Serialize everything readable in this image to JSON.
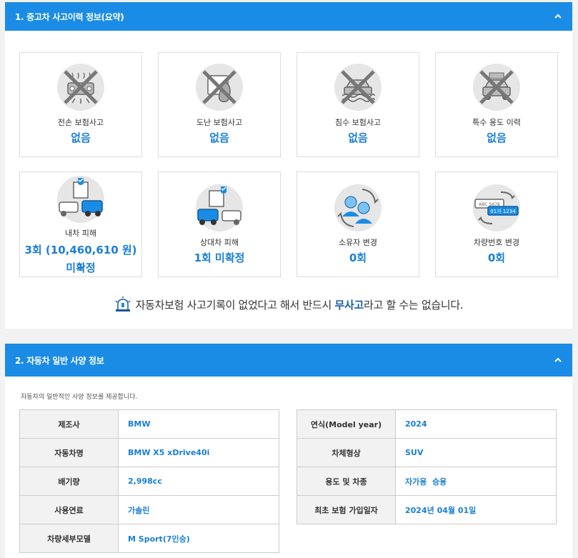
{
  "section1": {
    "title": "1. 중고차 사고이력 정보(요약)",
    "cards": [
      {
        "label": "전손 보험사고",
        "value": "없음",
        "icon": "total-loss-icon"
      },
      {
        "label": "도난 보험사고",
        "value": "없음",
        "icon": "theft-icon"
      },
      {
        "label": "침수 보험사고",
        "value": "없음",
        "icon": "flood-icon"
      },
      {
        "label": "특수 용도 이력",
        "value": "없음",
        "icon": "taxi-icon"
      },
      {
        "label": "내차 피해",
        "value": "3회 (10,460,610 원) +",
        "value2": "미확정",
        "icon": "own-damage-icon"
      },
      {
        "label": "상대차 피해",
        "value": "1회 미확정",
        "icon": "other-damage-icon"
      },
      {
        "label": "소유자 변경",
        "value": "0회",
        "icon": "owner-change-icon"
      },
      {
        "label": "차량번호 변경",
        "value": "0회",
        "icon": "plate-change-icon"
      }
    ],
    "notice": {
      "pre": "자동차보험 사고기록이 없었다고 해서 반드시 ",
      "bold": "무사고",
      "post": "라고 할 수는 없습니다."
    },
    "plate_old": "ABC 5678",
    "plate_new": "01가 1234"
  },
  "section2": {
    "title": "2. 자동차 일반 사양 정보",
    "intro": "자동차의 일반적인 사양 정보를 제공합니다.",
    "left_rows": [
      {
        "k": "제조사",
        "v": "BMW"
      },
      {
        "k": "자동차명",
        "v": "BMW X5 xDrive40i"
      },
      {
        "k": "배기량",
        "v": "2,998cc"
      },
      {
        "k": "사용연료",
        "v": "가솔린"
      },
      {
        "k": "차량세부모델",
        "v": "M Sport(7인승)"
      }
    ],
    "right_rows": [
      {
        "k": "연식(Model year)",
        "v": "2024"
      },
      {
        "k": "차체형상",
        "v": "SUV"
      },
      {
        "k": "용도 및 차종",
        "v": "자가용  승용"
      },
      {
        "k": "최초 보험 가입일자",
        "v": "2024년 04월 01일"
      }
    ]
  },
  "colors": {
    "header": "#1a8ce6",
    "value": "#1a7fd4"
  }
}
